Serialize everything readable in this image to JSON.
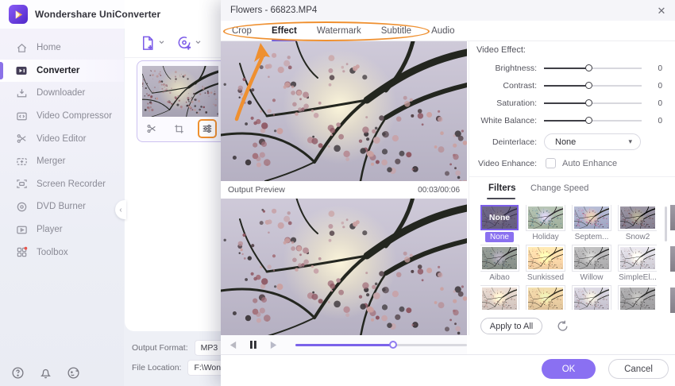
{
  "app": {
    "title": "Wondershare UniConverter",
    "sidebar": {
      "items": [
        {
          "label": "Home"
        },
        {
          "label": "Converter",
          "active": true
        },
        {
          "label": "Downloader"
        },
        {
          "label": "Video Compressor"
        },
        {
          "label": "Video Editor"
        },
        {
          "label": "Merger"
        },
        {
          "label": "Screen Recorder"
        },
        {
          "label": "DVD Burner"
        },
        {
          "label": "Player"
        },
        {
          "label": "Toolbox"
        }
      ]
    },
    "output_format_label": "Output Format:",
    "output_format_value": "MP3",
    "file_location_label": "File Location:",
    "file_location_value": "F:\\Wonde"
  },
  "icons": {
    "close": "✕",
    "collapse": "‹",
    "chevron_down": "⌄",
    "dropdown_chevron": "▾"
  },
  "dialog": {
    "title": "Flowers - 66823.MP4",
    "tabs": [
      {
        "label": "Crop"
      },
      {
        "label": "Effect",
        "active": true
      },
      {
        "label": "Watermark"
      },
      {
        "label": "Subtitle"
      },
      {
        "label": "Audio"
      }
    ],
    "preview": {
      "output_preview_label": "Output Preview",
      "timecode": "00:03/00:06",
      "progress_percent": 57
    },
    "effects": {
      "section_label": "Video Effect:",
      "sliders": [
        {
          "label": "Brightness:",
          "value": "0",
          "position": 46
        },
        {
          "label": "Contrast:",
          "value": "0",
          "position": 46
        },
        {
          "label": "Saturation:",
          "value": "0",
          "position": 46
        },
        {
          "label": "White Balance:",
          "value": "0",
          "position": 46
        }
      ],
      "deinterlace_label": "Deinterlace:",
      "deinterlace_value": "None",
      "video_enhance_label": "Video Enhance:",
      "auto_enhance_label": "Auto Enhance",
      "auto_enhance_checked": false
    },
    "filters_panel": {
      "tabs": [
        {
          "label": "Filters",
          "active": true
        },
        {
          "label": "Change Speed"
        }
      ],
      "filters": [
        {
          "name": "None",
          "selected": true
        },
        {
          "name": "Holiday"
        },
        {
          "name": "Septem..."
        },
        {
          "name": "Snow2"
        },
        {
          "name": "Aibao"
        },
        {
          "name": "Sunkissed"
        },
        {
          "name": "Willow"
        },
        {
          "name": "SimpleEl..."
        }
      ],
      "apply_all_label": "Apply to All"
    },
    "footer": {
      "ok_label": "OK",
      "cancel_label": "Cancel"
    }
  },
  "colors": {
    "accent_purple": "#7b5fe8",
    "annotation_orange": "#ef9030",
    "ok_button": "#8a70f2",
    "sidebar_active_bar": "#8b72e8"
  }
}
